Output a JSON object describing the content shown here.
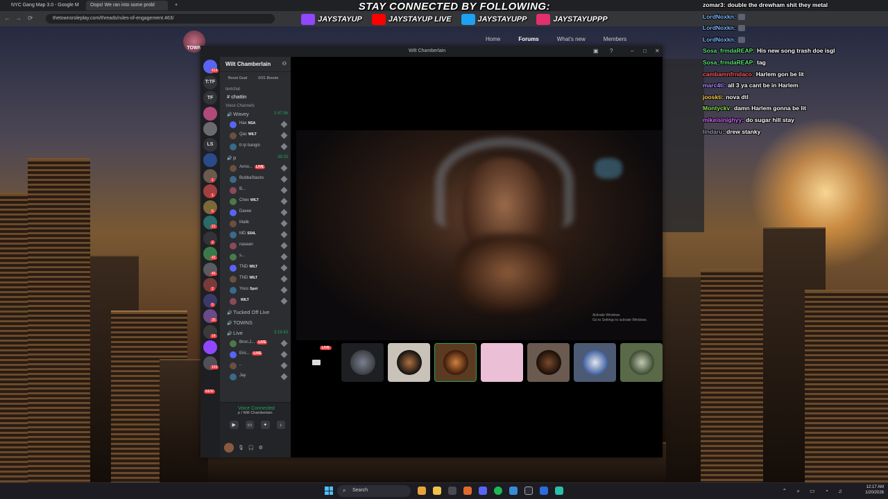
{
  "browser": {
    "tabs": [
      {
        "label": "NYC Gang Map 3.0 - Google M"
      },
      {
        "label": "Oops! We ran into some probl"
      }
    ],
    "url": "thetownsroleplay.com/threads/rules-of-engagement.463/"
  },
  "overlay": {
    "title": "STAY CONNECTED BY FOLLOWING:",
    "socials": [
      {
        "icon": "twitch-icon",
        "handle": "JAYSTAYUP",
        "color": "#9146ff"
      },
      {
        "icon": "youtube-icon",
        "handle": "JAYSTAYUP LIVE",
        "color": "#ff0000"
      },
      {
        "icon": "twitter-icon",
        "handle": "JAYSTAYUPP",
        "color": "#1da1f2"
      },
      {
        "icon": "instagram-icon",
        "handle": "JAYSTAYUPPP",
        "color": "#e1306c"
      }
    ]
  },
  "site": {
    "logo": "TOWN",
    "nav": {
      "home": "Home",
      "forums": "Forums",
      "whats_new": "What's new",
      "members": "Members"
    }
  },
  "discord": {
    "window_title": "Wilt Chamberlain",
    "server_name": "Wilt Chamberlain",
    "servers": [
      {
        "label": "",
        "badge": "414"
      },
      {
        "label": "T:TF",
        "badge": ""
      },
      {
        "label": "TF",
        "badge": ""
      },
      {
        "label": "",
        "badge": ""
      },
      {
        "label": "",
        "badge": ""
      },
      {
        "label": "LS",
        "badge": ""
      },
      {
        "label": "",
        "badge": ""
      },
      {
        "label": "",
        "badge": "1"
      },
      {
        "label": "",
        "badge": "1"
      },
      {
        "label": "",
        "badge": "5"
      },
      {
        "label": "",
        "badge": "21"
      },
      {
        "label": "",
        "badge": "2"
      },
      {
        "label": "",
        "badge": "42"
      },
      {
        "label": "",
        "badge": "46"
      },
      {
        "label": "",
        "badge": "2"
      },
      {
        "label": "",
        "badge": "5"
      },
      {
        "label": "",
        "badge": "35"
      },
      {
        "label": "",
        "badge": "14"
      },
      {
        "label": "",
        "badge": ""
      },
      {
        "label": "",
        "badge": "143"
      }
    ],
    "new_label": "NEW",
    "boost_goal": "Boost Goal",
    "boosts": "0/31 Boosts",
    "text_category": "textchat",
    "text_channel": "chattin",
    "voice_category": "Voice Channels",
    "voice_channels": [
      {
        "name": "Wavey",
        "timer": "2:47:56",
        "users": [
          {
            "name": "Hax",
            "tag": "NSA",
            "live": false
          },
          {
            "name": "Qac",
            "tag": "WILT",
            "live": false
          },
          {
            "name": "tt rp bangin",
            "tag": "",
            "live": false
          }
        ]
      },
      {
        "name": "p",
        "timer": "36:33",
        "users": [
          {
            "name": "Anno...",
            "tag": "",
            "live": true
          },
          {
            "name": "BubbaStacks",
            "tag": "",
            "live": false
          },
          {
            "name": "B...",
            "tag": "",
            "live": false
          },
          {
            "name": "Chev",
            "tag": "WILT",
            "live": false
          },
          {
            "name": "Davee",
            "tag": "",
            "live": false
          },
          {
            "name": "Malik",
            "tag": "",
            "live": false
          },
          {
            "name": "MD",
            "tag": "SS4L",
            "live": false
          },
          {
            "name": "nasean",
            "tag": "",
            "live": false
          },
          {
            "name": "s...",
            "tag": "",
            "live": false
          },
          {
            "name": "TND",
            "tag": "WILT",
            "live": false
          },
          {
            "name": "TND",
            "tag": "WILT",
            "live": false
          },
          {
            "name": "Yous",
            "tag": "Spot",
            "live": false
          },
          {
            "name": "",
            "tag": "WILT",
            "live": false
          }
        ]
      },
      {
        "name": "Tucked Off Live",
        "timer": "",
        "users": []
      },
      {
        "name": "TOWNS",
        "timer": "",
        "users": []
      },
      {
        "name": "Live",
        "timer": "3:19:43",
        "users": [
          {
            "name": "Bron.J...",
            "tag": "",
            "live": true
          },
          {
            "name": "Eric...",
            "tag": "",
            "live": true
          },
          {
            "name": "..",
            "tag": "",
            "live": false
          },
          {
            "name": "Jay",
            "tag": "",
            "live": false
          }
        ]
      }
    ],
    "voice_status": "Voice Connected",
    "voice_sub": "p / Wilt Chamberlain",
    "live_label": "LIVE",
    "activate_title": "Activate Windows",
    "activate_sub": "Go to Settings to activate Windows."
  },
  "chat": [
    {
      "user": "zomar3:",
      "color": "#ffffff",
      "msg": "double the drewham shit they metal",
      "emote": false
    },
    {
      "user": "LordNoxkn:",
      "color": "#7fb6ff",
      "msg": "",
      "emote": true
    },
    {
      "user": "LordNoxkn:",
      "color": "#7fb6ff",
      "msg": "",
      "emote": true
    },
    {
      "user": "LordNoxkn:",
      "color": "#7fb6ff",
      "msg": "",
      "emote": true
    },
    {
      "user": "Sosa_frmdaREAP:",
      "color": "#5fe07a",
      "msg": "His new song trash doe isgl",
      "emote": false
    },
    {
      "user": "Sosa_frmdaREAP:",
      "color": "#5fe07a",
      "msg": "tag",
      "emote": false
    },
    {
      "user": "cambamnfrndaco:",
      "color": "#ff5a5a",
      "msg": "Harlem gon be lit",
      "emote": false
    },
    {
      "user": "marc4ti:",
      "color": "#b18bff",
      "msg": "all 3 ya cant be in Harlem",
      "emote": false
    },
    {
      "user": "jooskti:",
      "color": "#ffd24a",
      "msg": "nova dtl",
      "emote": false
    },
    {
      "user": "Montyckv:",
      "color": "#8fe05a",
      "msg": "damn Harlem gonna be lit",
      "emote": false
    },
    {
      "user": "mikeisinighyy:",
      "color": "#d36bff",
      "msg": "do sugar hill stay",
      "emote": false
    },
    {
      "user": "lindaru:",
      "color": "#9a9ab0",
      "msg": "drew stanky",
      "emote": false
    }
  ],
  "taskbar": {
    "search_placeholder": "Search",
    "time": "12:17 AM",
    "date": "1/20/2026"
  }
}
